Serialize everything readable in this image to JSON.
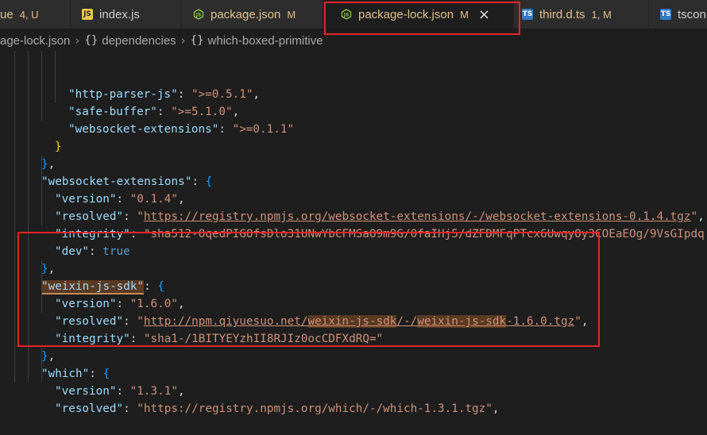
{
  "tabs": [
    {
      "label": "ue",
      "status": "4, U",
      "icon": "none"
    },
    {
      "label": "index.js",
      "status": "",
      "icon": "js-file-icon"
    },
    {
      "label": "package.json",
      "status": "M",
      "icon": "nodejs-file-icon"
    },
    {
      "label": "package-lock.json",
      "status": "M",
      "icon": "nodejs-file-icon",
      "active": true
    },
    {
      "label": "third.d.ts",
      "status": "1, M",
      "icon": "ts-file-icon"
    },
    {
      "label": "tscon",
      "status": "",
      "icon": "ts-file-icon"
    }
  ],
  "icons": {
    "js": "JS",
    "ts": "TS",
    "close": "×"
  },
  "breadcrumb": {
    "file": "age-lock.json",
    "separator": "›",
    "brace": "{}",
    "seg1": "dependencies",
    "seg2": "which-boxed-primitive"
  },
  "code": {
    "l1": {
      "key": "\"http-parser-js\"",
      "colon": ": ",
      "val": "\">=0.5.1\"",
      "comma": ","
    },
    "l2": {
      "key": "\"safe-buffer\"",
      "colon": ": ",
      "val": "\">=5.1.0\"",
      "comma": ","
    },
    "l3": {
      "key": "\"websocket-extensions\"",
      "colon": ": ",
      "val": "\">=0.1.1\""
    },
    "l4": {
      "close": "}"
    },
    "l5": {
      "close": "}",
      "comma": ","
    },
    "l6": {
      "key": "\"websocket-extensions\"",
      "colon": ": ",
      "open": "{"
    },
    "l7": {
      "key": "\"version\"",
      "colon": ": ",
      "val": "\"0.1.4\"",
      "comma": ","
    },
    "l8": {
      "key": "\"resolved\"",
      "colon": ": ",
      "q": "\"",
      "url": "https://registry.npmjs.org/websocket-extensions/-/websocket-extensions-0.1.4.tgz",
      "comma": ","
    },
    "l9": {
      "key": "\"integrity\"",
      "colon": ": ",
      "val": "\"sha512-OqedPIGOfsDlo31UNwYbCFMSaO9m9G/0faIHj5/dZFDMFqPTcx6UwqyOy3COEaEOg/9VsGIpdq"
    },
    "l10": {
      "key": "\"dev\"",
      "colon": ": ",
      "val": "true"
    },
    "l11": {
      "close": "}",
      "comma": ","
    },
    "l12": {
      "key": "\"weixin-js-sdk\"",
      "colon": ": ",
      "open": "{"
    },
    "l13": {
      "key": "\"version\"",
      "colon": ": ",
      "val": "\"1.6.0\"",
      "comma": ","
    },
    "l14": {
      "key": "\"resolved\"",
      "colon": ": ",
      "q": "\"",
      "u1": "http://npm.qiyuesuo.net/",
      "u2": "weixin-js-sdk",
      "u3": "/-/",
      "u4": "weixin-js-sdk",
      "u5": "-1.6.0.tgz",
      "comma": ","
    },
    "l15": {
      "key": "\"integrity\"",
      "colon": ": ",
      "val": "\"sha1-/1BITYEYzhII8RJIz0ocCDFXdRQ=\""
    },
    "l16": {
      "close": "}",
      "comma": ","
    },
    "l17": {
      "key": "\"which\"",
      "colon": ": ",
      "open": "{"
    },
    "l18": {
      "key": "\"version\"",
      "colon": ": ",
      "val": "\"1.3.1\"",
      "comma": ","
    },
    "l19": {
      "key": "\"resolved\"",
      "colon": ": ",
      "val": "\"https://registry.npmjs.org/which/-/which-1.3.1.tgz\"",
      "comma": ","
    }
  },
  "colors": {
    "highlight_box": "#e5252a",
    "editor_bg": "#1e1e1e"
  }
}
